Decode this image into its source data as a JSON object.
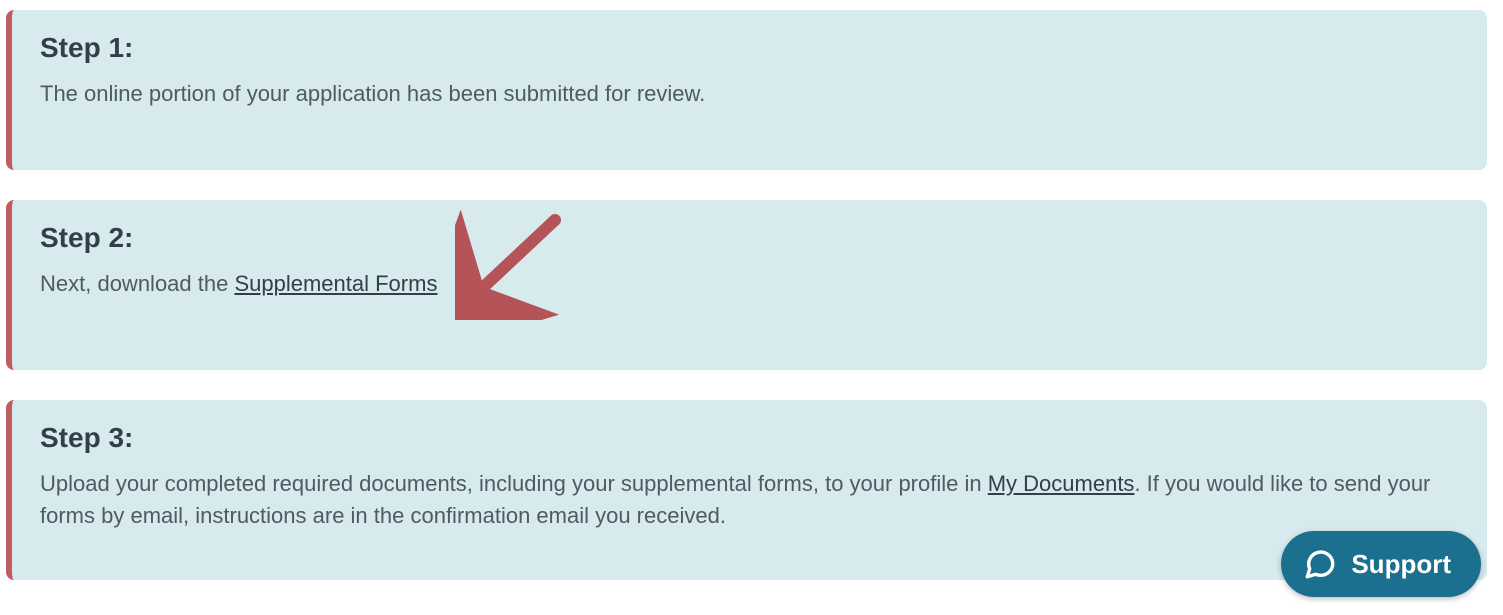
{
  "steps": [
    {
      "title": "Step 1:",
      "body_before": "The online portion of your application has been submitted for review.",
      "link_text": "",
      "body_after": ""
    },
    {
      "title": "Step 2:",
      "body_before": "Next, download the ",
      "link_text": "Supplemental Forms",
      "body_after": ""
    },
    {
      "title": "Step 3:",
      "body_before": "Upload your completed required documents, including your supplemental forms, to your profile in ",
      "link_text": "My Documents",
      "body_after": ". If you would like to send your forms by email, instructions are in the confirmation email you received."
    }
  ],
  "support": {
    "label": "Support"
  }
}
